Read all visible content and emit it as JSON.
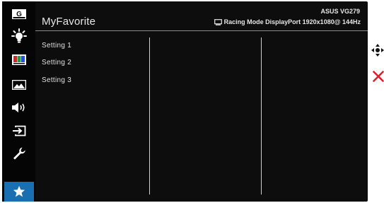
{
  "header": {
    "title": "MyFavorite",
    "model": "ASUS VG279",
    "status": "Racing Mode DisplayPort 1920x1080@ 144Hz"
  },
  "sidebar": {
    "items": [
      {
        "name": "gameplus",
        "label": "G",
        "icon": "gameplus-icon"
      },
      {
        "name": "splendid",
        "icon": "brightness-icon"
      },
      {
        "name": "color",
        "icon": "color-bars-icon"
      },
      {
        "name": "image",
        "icon": "image-icon"
      },
      {
        "name": "sound",
        "icon": "speaker-icon"
      },
      {
        "name": "input-select",
        "icon": "input-icon"
      },
      {
        "name": "system-setup",
        "icon": "wrench-icon"
      },
      {
        "name": "myfavorite",
        "icon": "star-icon",
        "active": true
      }
    ]
  },
  "settings": [
    "Setting 1",
    "Setting 2",
    "Setting 3"
  ],
  "controls": [
    {
      "name": "navigate",
      "icon": "five-way-nav-icon"
    },
    {
      "name": "exit",
      "icon": "close-icon",
      "color": "#e0202a"
    }
  ],
  "colors": {
    "accent": "#1a6fb0",
    "background": "#0d0d0d",
    "text": "#e0e0e0",
    "exit": "#e0202a"
  }
}
